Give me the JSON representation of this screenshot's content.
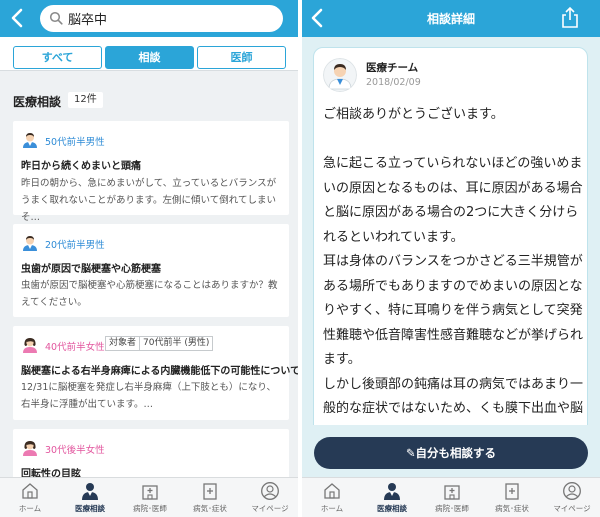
{
  "left": {
    "search": {
      "value": "脳卒中",
      "placeholder": ""
    },
    "tabs": [
      {
        "label": "すべて",
        "active": false
      },
      {
        "label": "相談",
        "active": true
      },
      {
        "label": "医師",
        "active": false
      }
    ],
    "section_title": "医療相談",
    "count": "12件",
    "cards": [
      {
        "meta": "50代前半男性",
        "gender": "male",
        "title": "昨日から続くめまいと頭痛",
        "body": "昨日の朝から、急にめまいがして、立っているとバランスがうまく取れないことがあります。左側に傾いて倒れてしまいそ…"
      },
      {
        "meta": "20代前半男性",
        "gender": "male",
        "title": "虫歯が原因で脳梗塞や心筋梗塞",
        "body": "虫歯が原因で脳梗塞や心筋梗塞になることはありますか？教えてください。"
      },
      {
        "meta": "40代前半女性",
        "gender": "female",
        "tags": [
          "対象者",
          "70代前半 (男性)"
        ],
        "title": "脳梗塞による右半身麻痺による内臓機能低下の可能性について",
        "body": "12/31に脳梗塞を発症し右半身麻痺（上下肢とも）になり、右半身に浮腫が出ています。…"
      },
      {
        "meta": "30代後半女性",
        "gender": "female",
        "title": "回転性の目眩",
        "body": ""
      }
    ]
  },
  "nav": [
    {
      "label": "ホーム",
      "icon": "home-icon",
      "active": false
    },
    {
      "label": "医療相談",
      "icon": "doctor-icon",
      "active": true
    },
    {
      "label": "病院･医師",
      "icon": "hospital-icon",
      "active": false
    },
    {
      "label": "病気･症状",
      "icon": "medical-book-icon",
      "active": false
    },
    {
      "label": "マイページ",
      "icon": "user-icon",
      "active": false
    }
  ],
  "right": {
    "title": "相談詳細",
    "doctor_name": "医療チーム",
    "date": "2018/02/09",
    "answer_lines": [
      "ご相談ありがとうございます。",
      "",
      "急に起こる立っていられないほどの強いめまいの原因となるものは、耳に原因がある場合と脳に原因がある場合の2つに大きく分けられるといわれています。",
      "耳は身体のバランスをつかさどる三半規管がある場所でもありますのでめまいの原因となりやすく、特に耳鳴りを伴う病気として突発性難聴や低音障害性感音難聴などが挙げられます。",
      "しかし後頭部の鈍痛は耳の病気ではあまり一般的な症状ではないため、くも膜下出血や脳出血など脳に原因がある可能性も考慮"
    ],
    "cta": "✎自分も相談する"
  },
  "colors": {
    "header": "#2ba5d8",
    "cta": "#263a55",
    "male": "#2e8bd6",
    "female": "#e2569e"
  }
}
